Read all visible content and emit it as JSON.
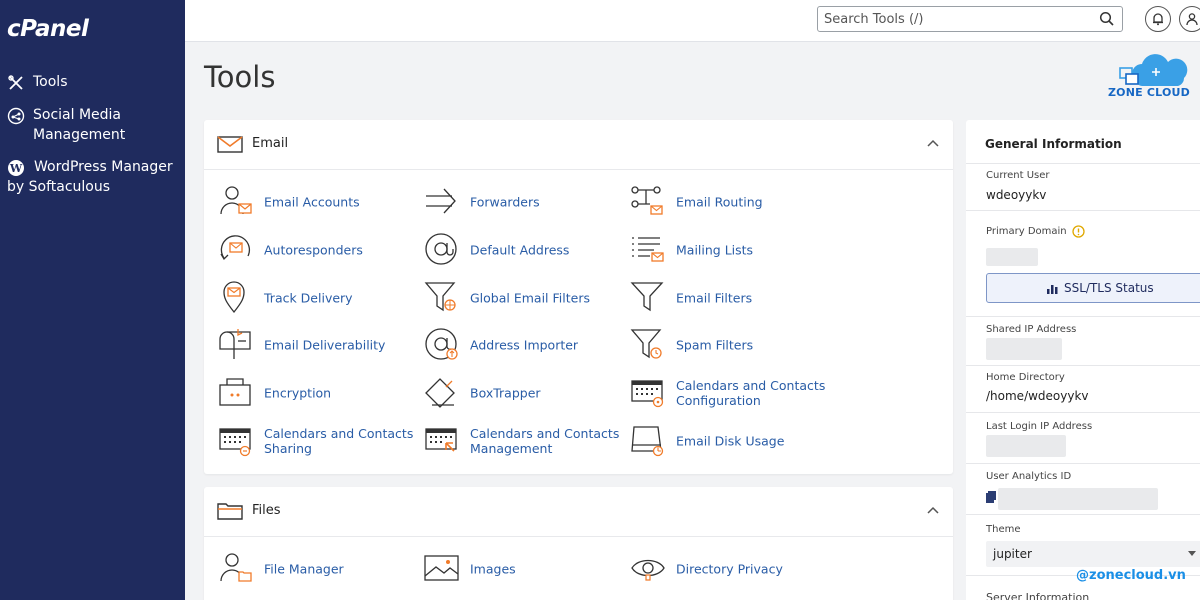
{
  "app": {
    "logo_text": "cPanel"
  },
  "sidebar": {
    "items": [
      {
        "label": "Tools",
        "icon": "tools-icon"
      },
      {
        "label": "Social Media Management",
        "icon": "social-media-icon"
      },
      {
        "label": "WordPress Manager by Softaculous",
        "icon": "wordpress-icon"
      }
    ]
  },
  "topbar": {
    "search_placeholder": "Search Tools (/)",
    "search_value": "",
    "notification_icon": "bell-icon",
    "user_icon": "user-icon"
  },
  "page": {
    "title": "Tools"
  },
  "brand": {
    "text": "ZONE CLOUD",
    "watermark": "@zonecloud.vn"
  },
  "sections": {
    "email": {
      "title": "Email",
      "tools": [
        {
          "label": "Email Accounts",
          "icon": "email-accounts-icon"
        },
        {
          "label": "Forwarders",
          "icon": "forwarders-icon"
        },
        {
          "label": "Email Routing",
          "icon": "email-routing-icon"
        },
        {
          "label": "Autoresponders",
          "icon": "autoresponders-icon"
        },
        {
          "label": "Default Address",
          "icon": "at-icon"
        },
        {
          "label": "Mailing Lists",
          "icon": "mailing-lists-icon"
        },
        {
          "label": "Track Delivery",
          "icon": "track-delivery-icon"
        },
        {
          "label": "Global Email Filters",
          "icon": "global-filter-icon"
        },
        {
          "label": "Email Filters",
          "icon": "filter-icon"
        },
        {
          "label": "Email Deliverability",
          "icon": "mailbox-icon"
        },
        {
          "label": "Address Importer",
          "icon": "address-importer-icon"
        },
        {
          "label": "Spam Filters",
          "icon": "spam-filter-icon"
        },
        {
          "label": "Encryption",
          "icon": "encryption-icon"
        },
        {
          "label": "BoxTrapper",
          "icon": "boxtrapper-icon"
        },
        {
          "label": "Calendars and Contacts Configuration",
          "icon": "calendar-config-icon"
        },
        {
          "label": "Calendars and Contacts Sharing",
          "icon": "calendar-sharing-icon"
        },
        {
          "label": "Calendars and Contacts Management",
          "icon": "calendar-management-icon"
        },
        {
          "label": "Email Disk Usage",
          "icon": "disk-usage-icon"
        }
      ]
    },
    "files": {
      "title": "Files",
      "tools": [
        {
          "label": "File Manager",
          "icon": "file-manager-icon"
        },
        {
          "label": "Images",
          "icon": "images-icon"
        },
        {
          "label": "Directory Privacy",
          "icon": "eye-icon"
        }
      ]
    }
  },
  "general_info": {
    "title": "General Information",
    "current_user_label": "Current User",
    "current_user": "wdeoyykv",
    "primary_domain_label": "Primary Domain",
    "ssl_button": "SSL/TLS Status",
    "shared_ip_label": "Shared IP Address",
    "home_dir_label": "Home Directory",
    "home_dir": "/home/wdeoyykv",
    "last_login_label": "Last Login IP Address",
    "analytics_label": "User Analytics ID",
    "theme_label": "Theme",
    "theme": "jupiter",
    "server_info_label": "Server Information"
  },
  "colors": {
    "sidebar": "#1f2b5e",
    "link": "#295ca6",
    "accent": "#f07b2a"
  }
}
